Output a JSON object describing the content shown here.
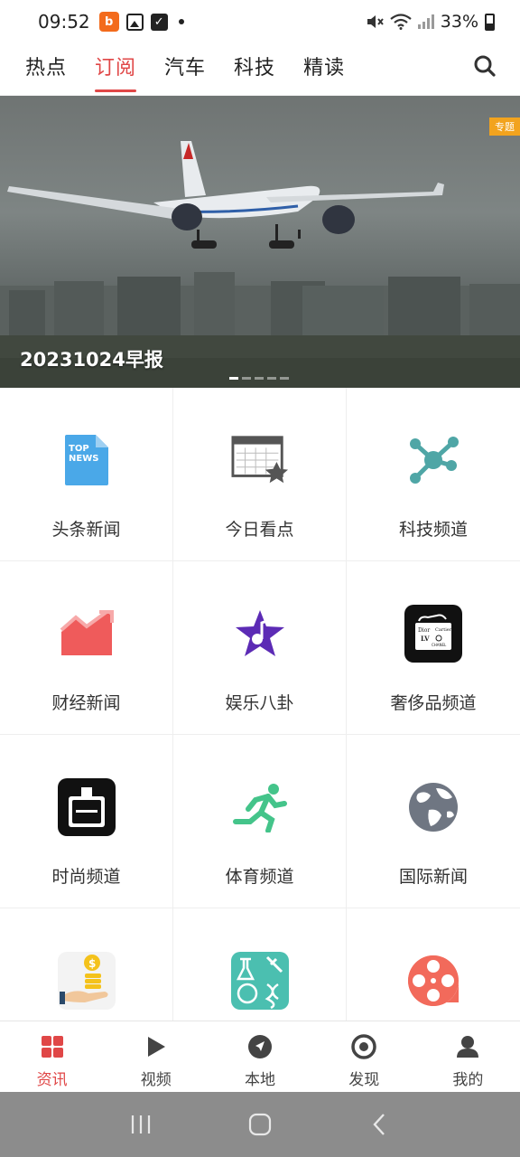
{
  "status_bar": {
    "time": "09:52",
    "battery": "33%",
    "notification_app_icon": "app-logo-icon"
  },
  "top_tabs": [
    {
      "label": "热点",
      "active": false
    },
    {
      "label": "订阅",
      "active": true
    },
    {
      "label": "汽车",
      "active": false
    },
    {
      "label": "科技",
      "active": false
    },
    {
      "label": "精读",
      "active": false
    }
  ],
  "banner": {
    "badge": "专题",
    "title": "20231024早报",
    "slide_count": 5,
    "active_slide": 1
  },
  "channels": [
    {
      "label": "头条新闻",
      "icon": "top-news-icon"
    },
    {
      "label": "今日看点",
      "icon": "calendar-star-icon"
    },
    {
      "label": "科技频道",
      "icon": "network-nodes-icon"
    },
    {
      "label": "财经新闻",
      "icon": "trend-chart-icon"
    },
    {
      "label": "娱乐八卦",
      "icon": "music-star-icon"
    },
    {
      "label": "奢侈品频道",
      "icon": "luxury-brands-icon"
    },
    {
      "label": "时尚频道",
      "icon": "perfume-bottle-icon"
    },
    {
      "label": "体育频道",
      "icon": "runner-icon"
    },
    {
      "label": "国际新闻",
      "icon": "globe-icon"
    },
    {
      "label": "",
      "icon": "coins-hand-icon"
    },
    {
      "label": "",
      "icon": "science-lab-icon"
    },
    {
      "label": "",
      "icon": "film-reel-icon"
    }
  ],
  "bottom_nav": [
    {
      "label": "资讯",
      "icon": "grid-icon",
      "active": true
    },
    {
      "label": "视频",
      "icon": "play-icon",
      "active": false
    },
    {
      "label": "本地",
      "icon": "compass-icon",
      "active": false
    },
    {
      "label": "发现",
      "icon": "target-icon",
      "active": false
    },
    {
      "label": "我的",
      "icon": "user-icon",
      "active": false
    }
  ],
  "colors": {
    "accent": "#e04747",
    "banner_badge": "#f2a31e",
    "system_nav_bg": "#8c8c8c"
  }
}
